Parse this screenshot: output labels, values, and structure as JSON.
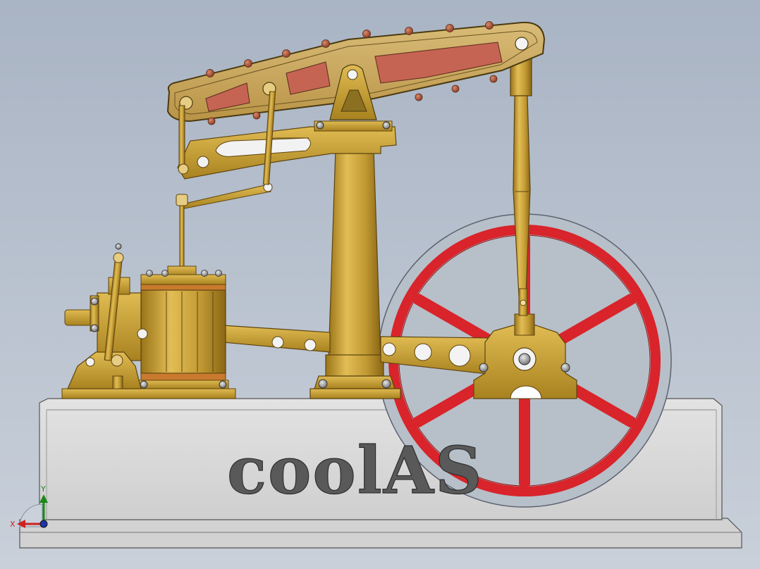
{
  "model": {
    "base_text": "coolAS"
  },
  "triad": {
    "x_label": "X",
    "y_label": "Y"
  },
  "colors": {
    "background_top": "#a9b4c4",
    "background_bottom": "#c9d0da",
    "brass": "#c9a23a",
    "brass_dark": "#7a5a14",
    "beam_panel": "#c56452",
    "flywheel_red": "#d8242a",
    "base_gray": "#d4d4d4",
    "bolt_copper": "#b4553a"
  }
}
